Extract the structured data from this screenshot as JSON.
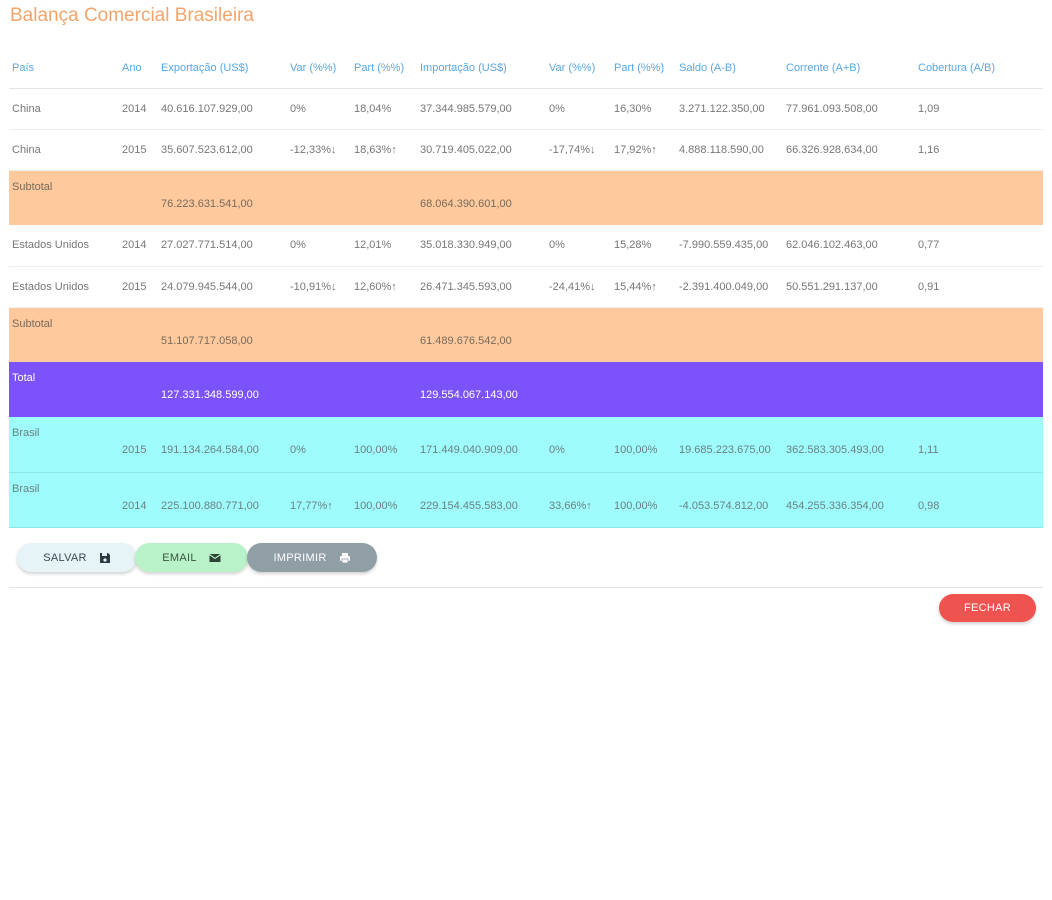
{
  "page": {
    "title": "Balança Comercial Brasileira"
  },
  "table": {
    "headers": [
      "País",
      "Ano",
      "Exportação (US$)",
      "Var (%%)",
      "Part (%%)",
      "Importação (US$)",
      "Var (%%)",
      "Part (%%)",
      "Saldo (A-B)",
      "Corrente (A+B)",
      "Cobertura (A/B)"
    ],
    "rows": [
      {
        "kind": "data",
        "cells": [
          "China",
          "2014",
          "40.616.107.929,00",
          "0%",
          "18,04%",
          "37.344.985.579,00",
          "0%",
          "16,30%",
          "3.271.122.350,00",
          "77.961.093.508,00",
          "1,09"
        ]
      },
      {
        "kind": "data",
        "cells": [
          "China",
          "2015",
          "35.607.523.612,00",
          "-12,33%↓",
          "18,63%↑",
          "30.719.405.022,00",
          "-17,74%↓",
          "17,92%↑",
          "4.888.118.590,00",
          "66.326.928.634,00",
          "1,16"
        ]
      },
      {
        "kind": "sub",
        "cells": [
          "Subtotal",
          "",
          "76.223.631.541,00",
          "",
          "",
          "68.064.390.601,00",
          "",
          "",
          "",
          "",
          ""
        ]
      },
      {
        "kind": "data",
        "cells": [
          "Estados Unidos",
          "2014",
          "27.027.771.514,00",
          "0%",
          "12,01%",
          "35.018.330.949,00",
          "0%",
          "15,28%",
          "-7.990.559.435,00",
          "62.046.102.463,00",
          "0,77"
        ]
      },
      {
        "kind": "data",
        "cells": [
          "Estados Unidos",
          "2015",
          "24.079.945.544,00",
          "-10,91%↓",
          "12,60%↑",
          "26.471.345.593,00",
          "-24,41%↓",
          "15,44%↑",
          "-2.391.400.049,00",
          "50.551.291.137,00",
          "0,91"
        ]
      },
      {
        "kind": "sub",
        "cells": [
          "Subtotal",
          "",
          "51.107.717.058,00",
          "",
          "",
          "61.489.676.542,00",
          "",
          "",
          "",
          "",
          ""
        ]
      },
      {
        "kind": "tot",
        "cells": [
          "Total",
          "",
          "127.331.348.599,00",
          "",
          "",
          "129.554.067.143,00",
          "",
          "",
          "",
          "",
          ""
        ]
      },
      {
        "kind": "br",
        "cells": [
          "Brasil",
          "2015",
          "191.134.264.584,00",
          "0%",
          "100,00%",
          "171.449.040.909,00",
          "0%",
          "100,00%",
          "19.685.223.675,00",
          "362.583.305.493,00",
          "1,11"
        ]
      },
      {
        "kind": "br",
        "cells": [
          "Brasil",
          "2014",
          "225.100.880.771,00",
          "17,77%↑",
          "100,00%",
          "229.154.455.583,00",
          "33,66%↑",
          "100,00%",
          "-4.053.574.812,00",
          "454.255.336.354,00",
          "0,98"
        ]
      }
    ]
  },
  "actions": {
    "save_label": "SALVAR",
    "email_label": "EMAIL",
    "print_label": "IMPRIMIR",
    "close_label": "FECHAR"
  },
  "icons": {
    "save": "floppy-icon",
    "email": "envelope-icon",
    "print": "printer-icon"
  },
  "colors": {
    "title": "#f4a46a",
    "header": "#5aa7e2",
    "subtotal": "#fdc99d",
    "total": "#7c52fb",
    "brasil": "#9ffcfd",
    "close": "#ef5350"
  }
}
